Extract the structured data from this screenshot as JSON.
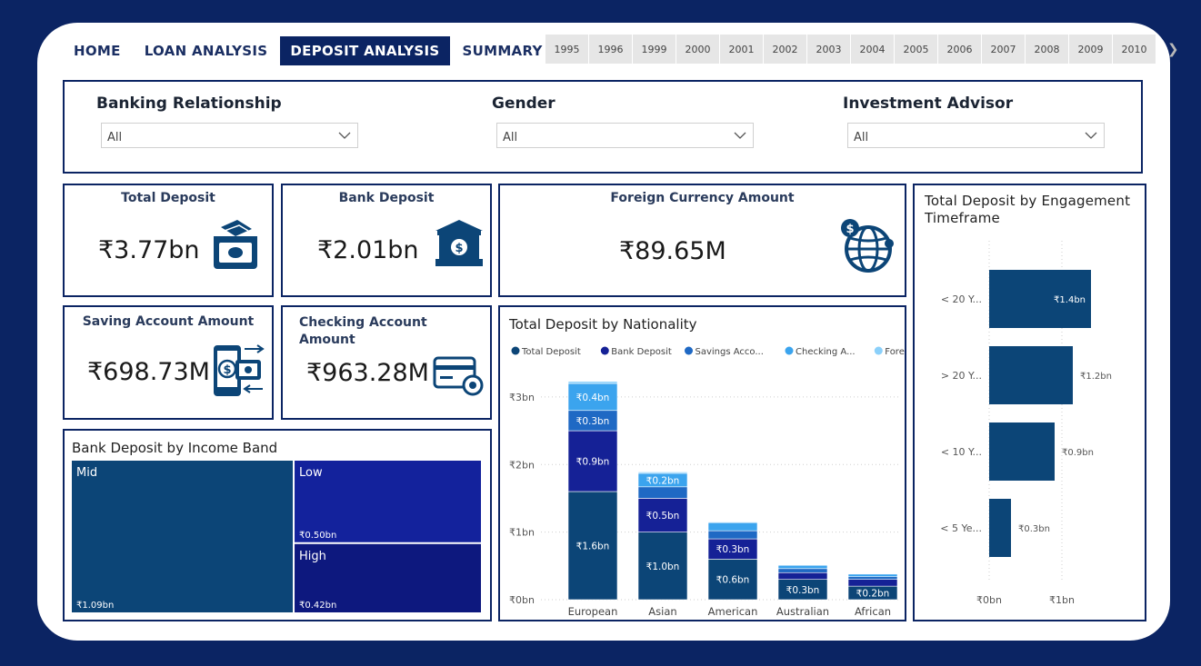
{
  "nav": {
    "tabs": [
      {
        "label": "HOME"
      },
      {
        "label": "LOAN ANALYSIS"
      },
      {
        "label": "DEPOSIT ANALYSIS"
      },
      {
        "label": "SUMMARY"
      }
    ],
    "active_tab": "DEPOSIT ANALYSIS",
    "years": [
      "1995",
      "1996",
      "1999",
      "2000",
      "2001",
      "2002",
      "2003",
      "2004",
      "2005",
      "2006",
      "2007",
      "2008",
      "2009",
      "2010"
    ]
  },
  "filters": [
    {
      "label": "Banking Relationship",
      "value": "All"
    },
    {
      "label": "Gender",
      "value": "All"
    },
    {
      "label": "Investment Advisor",
      "value": "All"
    }
  ],
  "kpis": {
    "total_deposit": {
      "title": "Total Deposit",
      "value": "₹3.77bn",
      "icon": "cash-icon"
    },
    "bank_deposit": {
      "title": "Bank Deposit",
      "value": "₹2.01bn",
      "icon": "bank-icon"
    },
    "foreign_currency": {
      "title": "Foreign Currency Amount",
      "value": "₹89.65M",
      "icon": "globe-dollar-icon"
    },
    "saving_account": {
      "title": "Saving Account Amount",
      "value": "₹698.73M",
      "icon": "mobile-banking-icon"
    },
    "checking_account": {
      "title": "Checking Account Amount",
      "value": "₹963.28M",
      "icon": "card-gear-icon"
    }
  },
  "colors": {
    "navy": "#0b2463",
    "total": "#0c4577",
    "bank": "#152196",
    "savings": "#1f69c4",
    "checking": "#3ba4ee",
    "foreign": "#8bd0fa"
  },
  "chart_data": [
    {
      "type": "treemap",
      "title": "Bank Deposit by Income Band",
      "categories": [
        "Mid",
        "Low",
        "High"
      ],
      "values": [
        1.09,
        0.5,
        0.42
      ],
      "value_labels": [
        "₹1.09bn",
        "₹0.50bn",
        "₹0.42bn"
      ],
      "colors": [
        "#0c4577",
        "#13229c",
        "#0d187e"
      ]
    },
    {
      "type": "bar",
      "stacked": true,
      "title": "Total Deposit by Nationality",
      "categories": [
        "European",
        "Asian",
        "American",
        "Australian",
        "African"
      ],
      "legend": [
        "Total Deposit",
        "Bank Deposit",
        "Savings Acco...",
        "Checking A...",
        "Foreign Curr..."
      ],
      "series": [
        {
          "name": "Total Deposit",
          "values": [
            1.6,
            1.0,
            0.6,
            0.3,
            0.2
          ],
          "labels": [
            "₹1.6bn",
            "₹1.0bn",
            "₹0.6bn",
            "₹0.3bn",
            "₹0.2bn"
          ]
        },
        {
          "name": "Bank Deposit",
          "values": [
            0.9,
            0.5,
            0.3,
            0.1,
            0.1
          ],
          "labels": [
            "₹0.9bn",
            "₹0.5bn",
            "₹0.3bn",
            "",
            ""
          ]
        },
        {
          "name": "Savings Acco...",
          "values": [
            0.3,
            0.17,
            0.12,
            0.06,
            0.04
          ],
          "labels": [
            "₹0.3bn",
            "",
            "",
            "",
            ""
          ]
        },
        {
          "name": "Checking A...",
          "values": [
            0.4,
            0.2,
            0.12,
            0.05,
            0.04
          ],
          "labels": [
            "₹0.4bn",
            "₹0.2bn",
            "",
            "",
            ""
          ]
        },
        {
          "name": "Foreign Curr...",
          "values": [
            0.03,
            0.02,
            0.01,
            0.005,
            0.005
          ],
          "labels": [
            "",
            "",
            "",
            "",
            ""
          ]
        }
      ],
      "yticks": [
        "₹0bn",
        "₹1bn",
        "₹2bn",
        "₹3bn"
      ],
      "ylim": [
        0,
        3.2
      ],
      "grid": true,
      "legend_position": "top-left"
    },
    {
      "type": "bar",
      "orientation": "horizontal",
      "title": "Total Deposit by Engagement Timeframe",
      "categories": [
        "< 20 Y...",
        "> 20 Y...",
        "< 10 Y...",
        "< 5 Ye..."
      ],
      "values": [
        1.4,
        1.15,
        0.9,
        0.3
      ],
      "value_labels": [
        "₹1.4bn",
        "₹1.2bn",
        "₹0.9bn",
        "₹0.3bn"
      ],
      "xticks": [
        "₹0bn",
        "₹1bn"
      ],
      "xlim": [
        0,
        1.6
      ],
      "grid": true
    }
  ]
}
